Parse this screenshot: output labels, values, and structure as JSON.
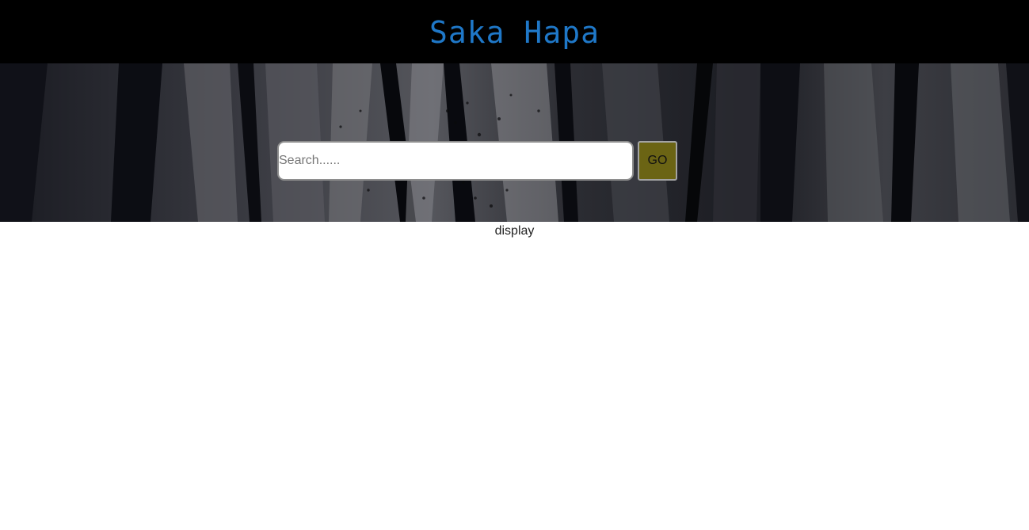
{
  "header": {
    "title": "Saka Hapa",
    "title_color": "#1f78c8",
    "background": "#000000"
  },
  "hero": {
    "background_image": "dark-rock-texture",
    "search": {
      "placeholder": "Search......",
      "value": ""
    },
    "go_button": {
      "label": "GO",
      "color": "#6b6414"
    }
  },
  "content": {
    "display_text": "display"
  }
}
